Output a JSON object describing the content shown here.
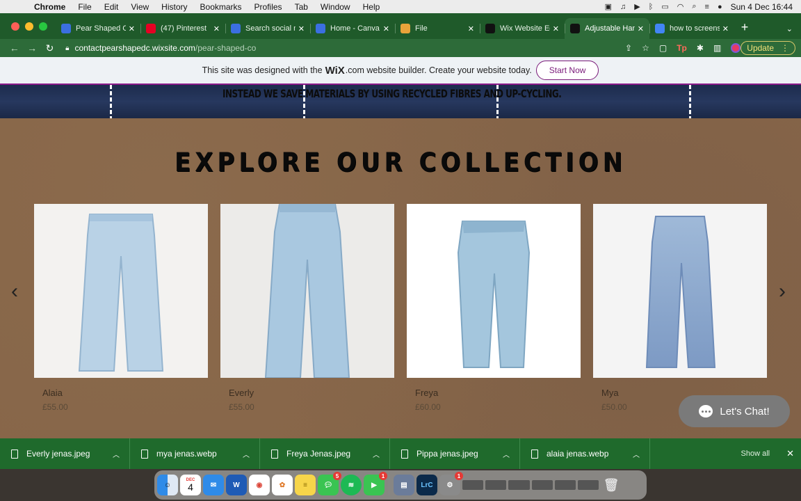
{
  "menubar": {
    "app_name": "Chrome",
    "items": [
      "File",
      "Edit",
      "View",
      "History",
      "Bookmarks",
      "Profiles",
      "Tab",
      "Window",
      "Help"
    ],
    "clock": "Sun 4 Dec  16:44"
  },
  "tabs": [
    {
      "title": "Pear Shaped Co",
      "icon": "canva-icon",
      "color": "#3b6fe0"
    },
    {
      "title": "(47) Pinterest",
      "icon": "pinterest-icon",
      "color": "#e60023"
    },
    {
      "title": "Search social m",
      "icon": "canva-icon",
      "color": "#3b6fe0"
    },
    {
      "title": "Home - Canva",
      "icon": "canva-icon",
      "color": "#3b6fe0"
    },
    {
      "title": "File",
      "icon": "file-icon",
      "color": "#e8a33a"
    },
    {
      "title": "Wix Website Ed",
      "icon": "wix-icon",
      "color": "#111111"
    },
    {
      "title": "Adjustable Han",
      "icon": "wix-icon",
      "color": "#111111"
    },
    {
      "title": "how to screens",
      "icon": "google-icon",
      "color": "#4285f4"
    }
  ],
  "address": {
    "domain": "contactpearshapedc.wixsite.com",
    "path": "/pear-shaped-co"
  },
  "update_label": "Update",
  "wix_banner": {
    "text_before": "This site was designed with the",
    "logo": "WiX",
    "text_after": ".com website builder. Create your website today.",
    "button": "Start Now"
  },
  "strip_text": "INSTEAD WE SAVE MATERIALS BY USING RECYCLED FIBRES AND UP-CYCLING.",
  "collection_title": "EXPLORE OUR COLLECTION",
  "products": [
    {
      "name": "Alaia",
      "price": "£55.00"
    },
    {
      "name": "Everly",
      "price": "£55.00"
    },
    {
      "name": "Freya",
      "price": "£60.00"
    },
    {
      "name": "Mya",
      "price": "£50.00"
    }
  ],
  "chat_label": "Let's Chat!",
  "downloads": [
    {
      "name": "Everly jenas.jpeg"
    },
    {
      "name": "mya jenas.webp"
    },
    {
      "name": "Freya Jenas.jpeg"
    },
    {
      "name": "Pippa jenas.jpeg"
    },
    {
      "name": "alaia jenas.webp"
    }
  ],
  "show_all": "Show all",
  "dock": {
    "calendar_day": "4",
    "calendar_month": "DEC",
    "messages_badge": "5",
    "facetime_badge": "1",
    "settings_badge": "1",
    "lightroom_label": "LrC"
  }
}
